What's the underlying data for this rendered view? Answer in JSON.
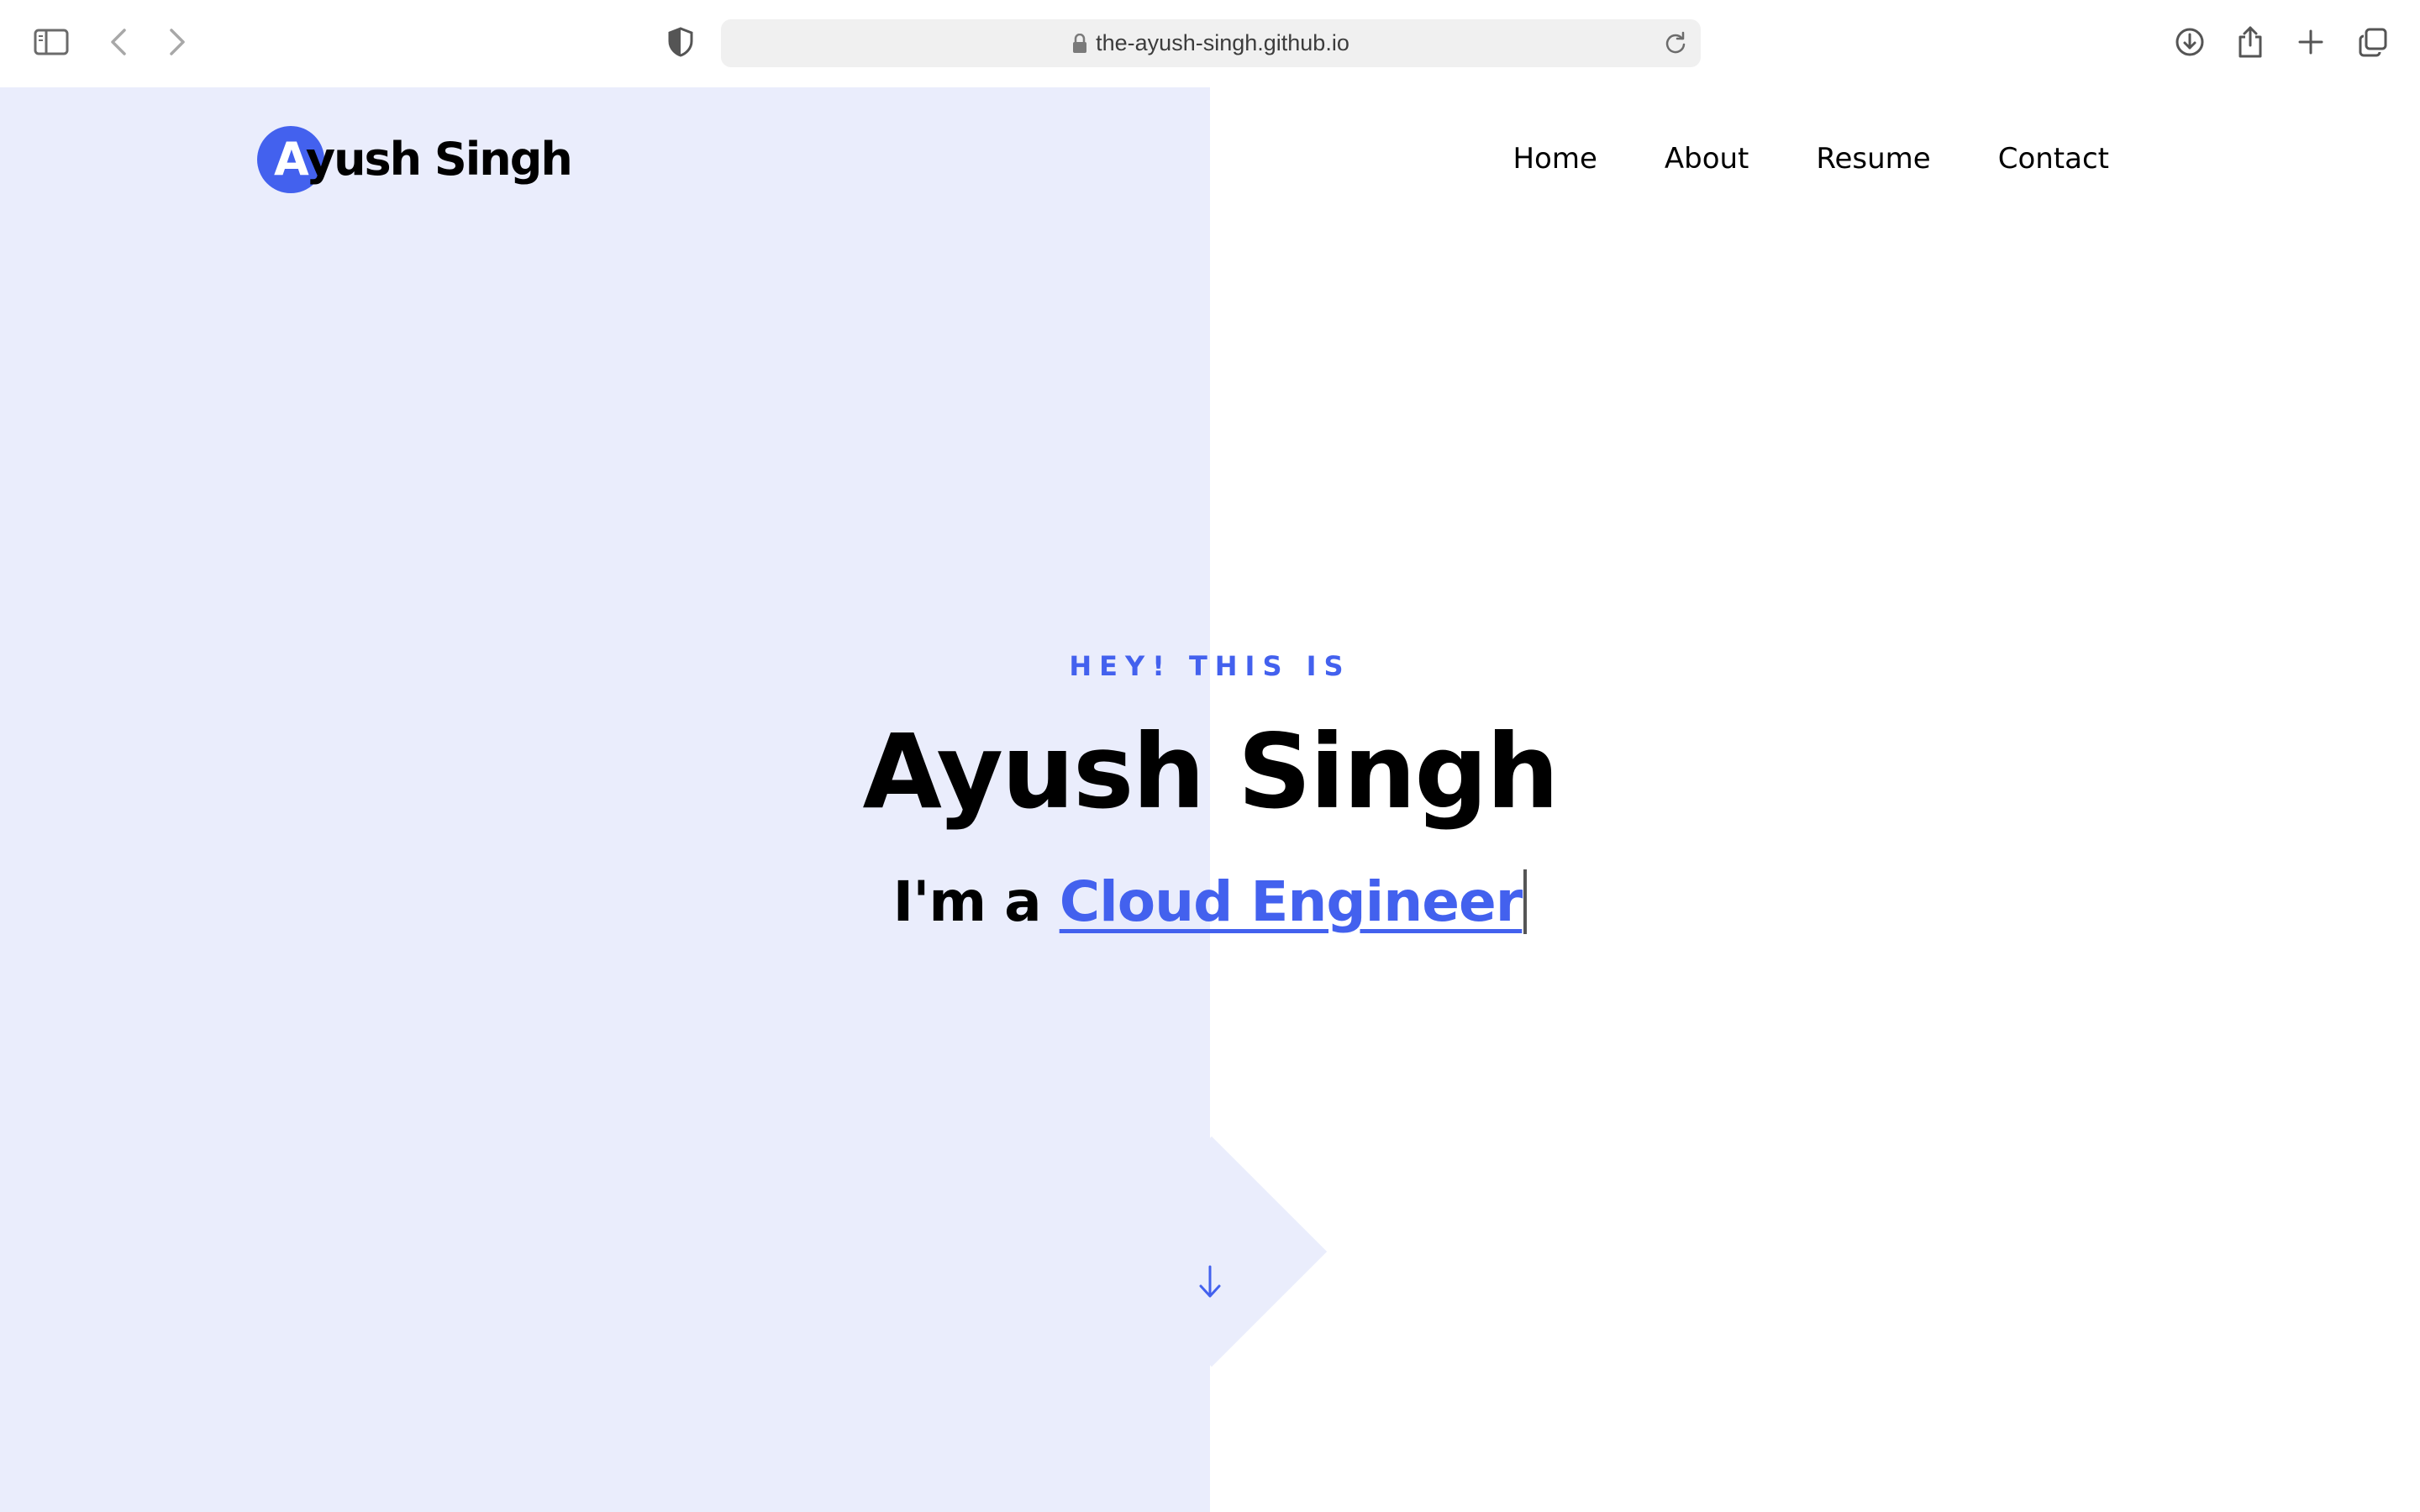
{
  "browser": {
    "url": "the-ayush-singh.github.io",
    "icons": {
      "sidebar": "sidebar-icon",
      "back": "chevron-left-icon",
      "forward": "chevron-right-icon",
      "shield": "shield-icon",
      "lock": "lock-icon",
      "reload": "reload-icon",
      "download": "download-icon",
      "share": "share-icon",
      "new_tab": "plus-icon",
      "tabs": "tabs-overview-icon"
    }
  },
  "site": {
    "logo": {
      "first_letter": "A",
      "rest": "yush Singh"
    },
    "nav": [
      {
        "label": "Home"
      },
      {
        "label": "About"
      },
      {
        "label": "Resume"
      },
      {
        "label": "Contact"
      }
    ],
    "hero": {
      "eyebrow": "HEY! THIS IS",
      "name": "Ayush Singh",
      "tagline_prefix": "I'm a ",
      "role": "Cloud Engineer"
    },
    "scroll_icon": "arrow-down-icon"
  },
  "colors": {
    "accent": "#4361ee",
    "panel": "#eaedfc",
    "text": "#000000"
  }
}
